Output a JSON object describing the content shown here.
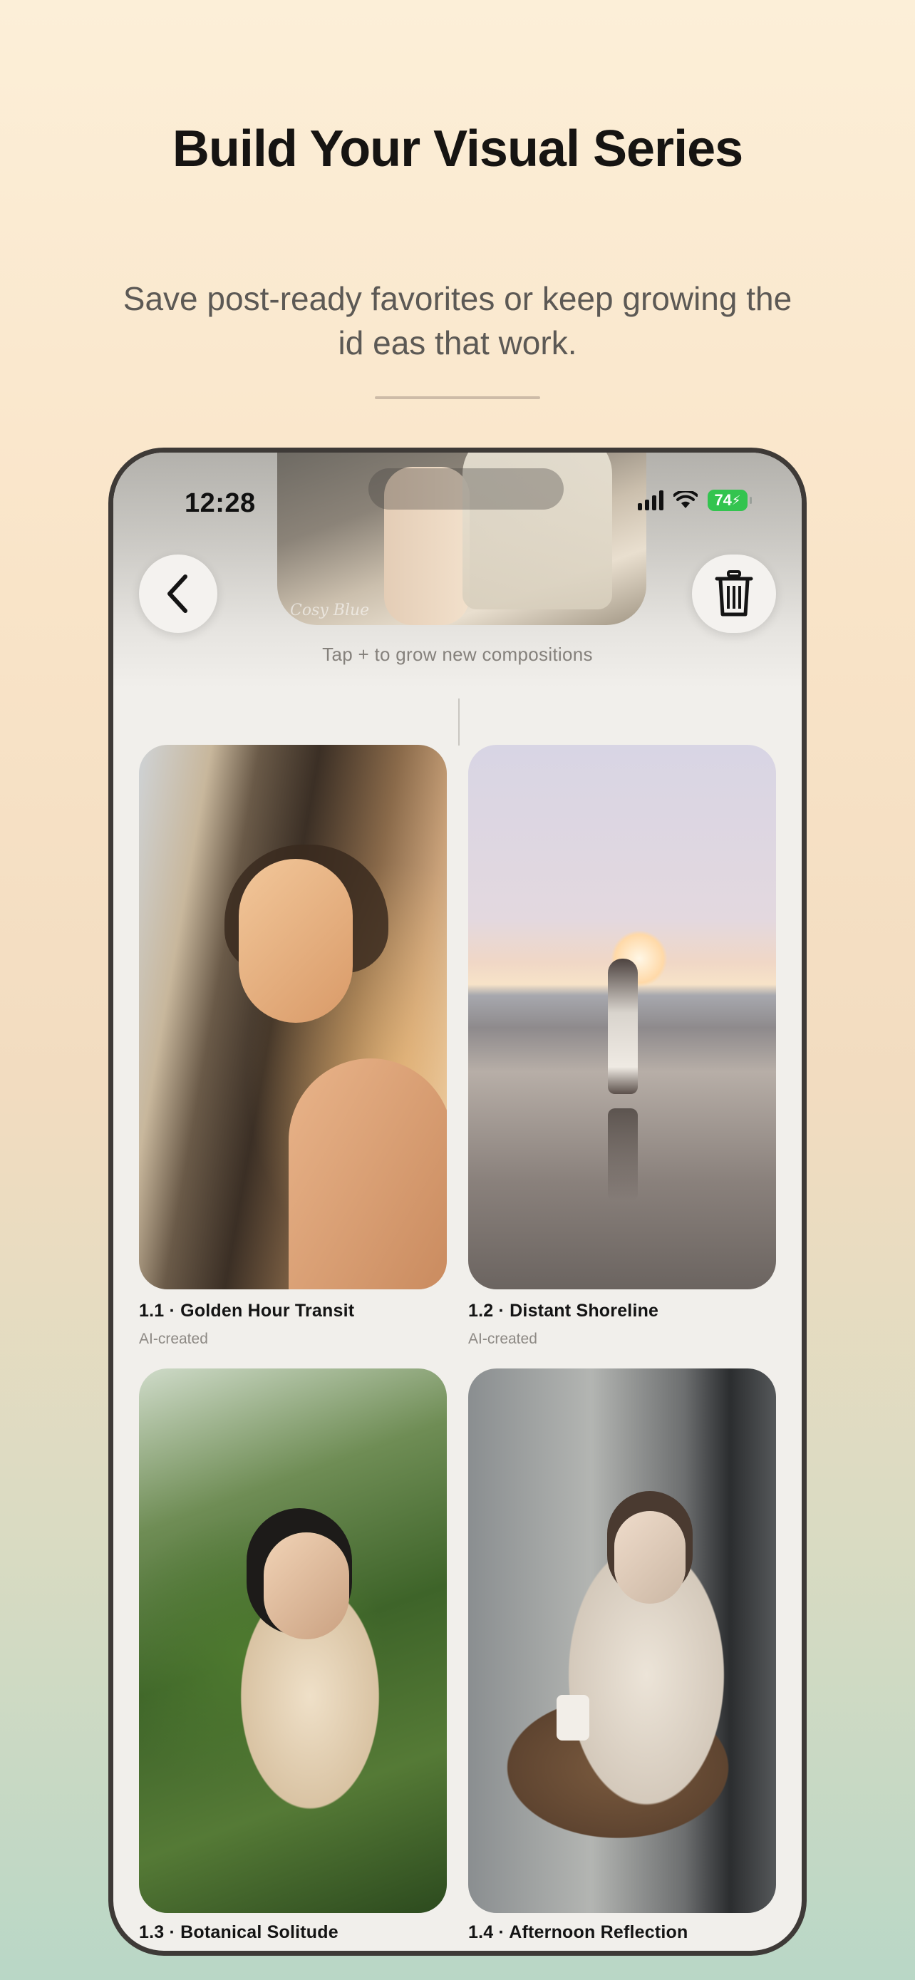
{
  "headline": "Build Your Visual Series",
  "subheadline": "Save post-ready favorites or keep growing the id eas that work.",
  "status_bar": {
    "time": "12:28",
    "battery": "74"
  },
  "top_photo": {
    "watermark": "Cosy Blue"
  },
  "hint": "Tap + to grow new compositions",
  "gallery": [
    {
      "title": "1.1 · Golden Hour Transit",
      "tag": "AI-created"
    },
    {
      "title": "1.2 · Distant Shoreline",
      "tag": "AI-created"
    },
    {
      "title": "1.3 · Botanical Solitude"
    },
    {
      "title": "1.4 · Afternoon Reflection"
    }
  ],
  "icons": {
    "back": "chevron-left-icon",
    "trash": "trash-icon",
    "signal": "cellular-signal-icon",
    "wifi": "wifi-icon",
    "battery": "battery-charging-icon"
  },
  "colors": {
    "background_top": "#fcefd8",
    "background_bottom": "#b9d7c6",
    "battery_green": "#33c44f",
    "phone_frame": "#3e3a37"
  }
}
